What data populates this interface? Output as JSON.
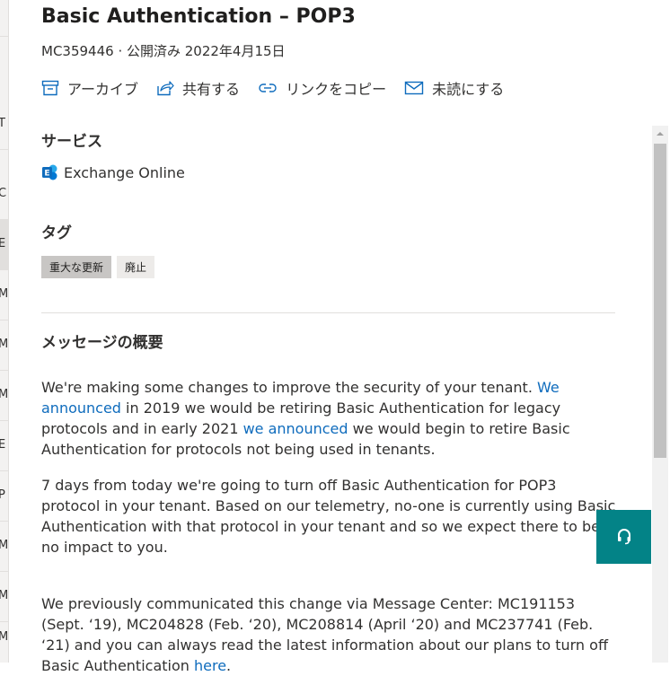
{
  "background_list": {
    "letters": [
      "T",
      "C",
      "E",
      "M",
      "M",
      "M",
      "E",
      "P",
      "M",
      "M",
      "M",
      "M"
    ]
  },
  "header": {
    "title": "Basic Authentication – POP3",
    "meta": "MC359446 · 公開済み 2022年4月15日"
  },
  "actions": [
    {
      "label": "アーカイブ",
      "icon": "archive-icon"
    },
    {
      "label": "共有する",
      "icon": "share-icon"
    },
    {
      "label": "リンクをコピー",
      "icon": "link-icon"
    },
    {
      "label": "未読にする",
      "icon": "mail-icon"
    }
  ],
  "services": {
    "heading": "サービス",
    "items": [
      {
        "label": "Exchange Online",
        "icon": "exchange-icon"
      }
    ]
  },
  "tags": {
    "heading": "タグ",
    "items": [
      "重大な更新",
      "廃止"
    ]
  },
  "summary": {
    "heading": "メッセージの概要",
    "p1": {
      "t1": "We're making some changes to improve the security of your tenant. ",
      "link1": "We announced",
      "t2": " in 2019 we would be retiring Basic Authentication for legacy protocols and in early 2021 ",
      "link2": "we announced",
      "t3": " we would begin to retire Basic Authentication for protocols not being used in tenants."
    },
    "p2": "7 days from today we're going to turn off Basic Authentication for POP3 protocol in your tenant. Based on our telemetry, no-one is currently using Basic Authentication with that protocol in your tenant and so we expect there to be no impact to you.",
    "p3": {
      "t1": "We previously communicated this change via Message Center: MC191153 (Sept. ‘19), MC204828 (Feb. ‘20), MC208814 (April ‘20) and MC237741 (Feb. ‘21) and you can always read the latest information about our plans to turn off Basic Authentication ",
      "link": "here",
      "t2": "."
    }
  },
  "colors": {
    "link": "#0f6cbd",
    "accent": "#038387",
    "icon_blue": "#0f6cbd"
  },
  "help_button": {
    "icon": "headset-icon"
  }
}
